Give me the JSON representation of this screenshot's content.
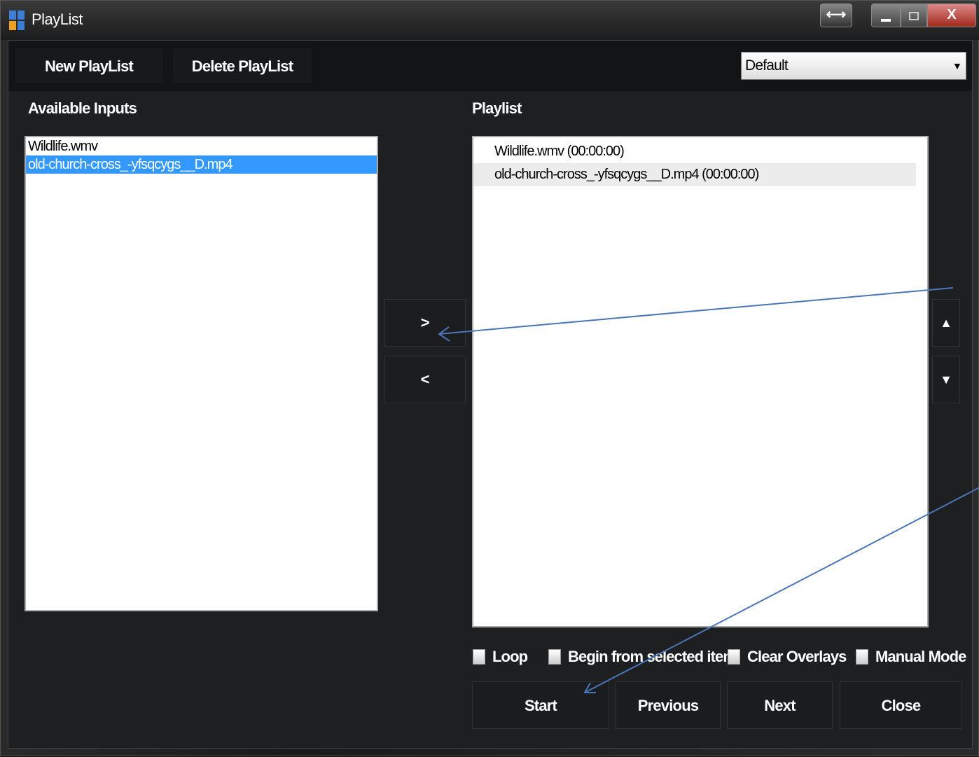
{
  "window": {
    "title": "PlayList"
  },
  "toolbar": {
    "new_playlist": "New PlayList",
    "delete_playlist": "Delete PlayList",
    "playlist_select": {
      "selected": "Default"
    }
  },
  "available_inputs": {
    "heading": "Available Inputs",
    "items": [
      "Wildlife.wmv",
      "old-church-cross_-yfsqcygs__D.mp4"
    ],
    "selected_index": 1
  },
  "playlist": {
    "heading": "Playlist",
    "items": [
      "Wildlife.wmv (00:00:00)",
      "old-church-cross_-yfsqcygs__D.mp4 (00:00:00)"
    ]
  },
  "transfer": {
    "add_label": ">",
    "remove_label": "<"
  },
  "reorder": {
    "up_icon": "triangle-up-icon",
    "down_icon": "triangle-down-icon"
  },
  "options": {
    "loop": "Loop",
    "begin_from_selected": "Begin from selected item",
    "clear_overlays": "Clear Overlays",
    "manual_mode": "Manual Mode"
  },
  "controls": {
    "start": "Start",
    "previous": "Previous",
    "next": "Next",
    "close": "Close"
  },
  "colors": {
    "selection": "#3399ff",
    "annotation_arrow": "#4a76b8",
    "window_bg": "#1e1f20"
  }
}
